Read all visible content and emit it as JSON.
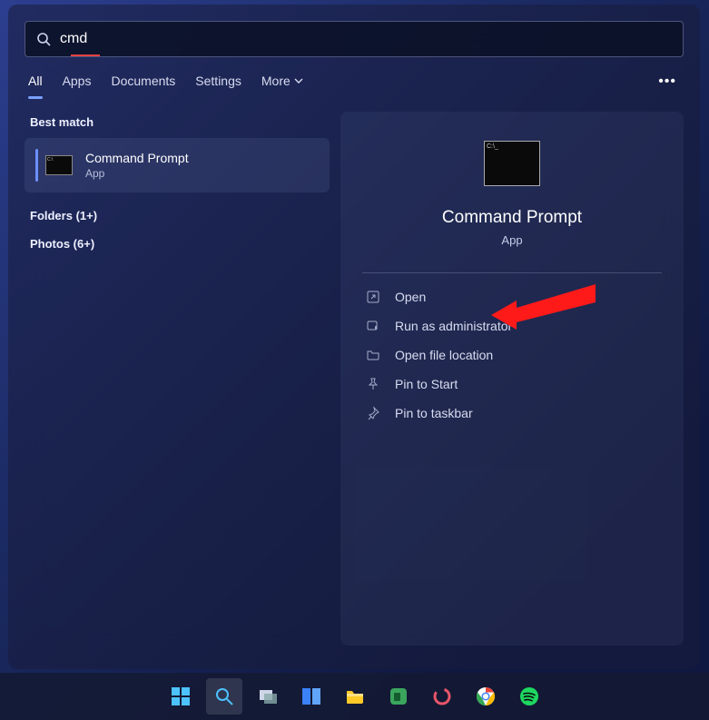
{
  "search": {
    "query": "cmd"
  },
  "tabs": {
    "items": [
      "All",
      "Apps",
      "Documents",
      "Settings"
    ],
    "more": "More"
  },
  "left": {
    "best_match_label": "Best match",
    "result": {
      "title": "Command Prompt",
      "subtitle": "App"
    },
    "categories": [
      "Folders (1+)",
      "Photos (6+)"
    ]
  },
  "preview": {
    "title": "Command Prompt",
    "subtitle": "App"
  },
  "actions": {
    "open": "Open",
    "run_admin": "Run as administrator",
    "open_loc": "Open file location",
    "pin_start": "Pin to Start",
    "pin_taskbar": "Pin to taskbar"
  }
}
